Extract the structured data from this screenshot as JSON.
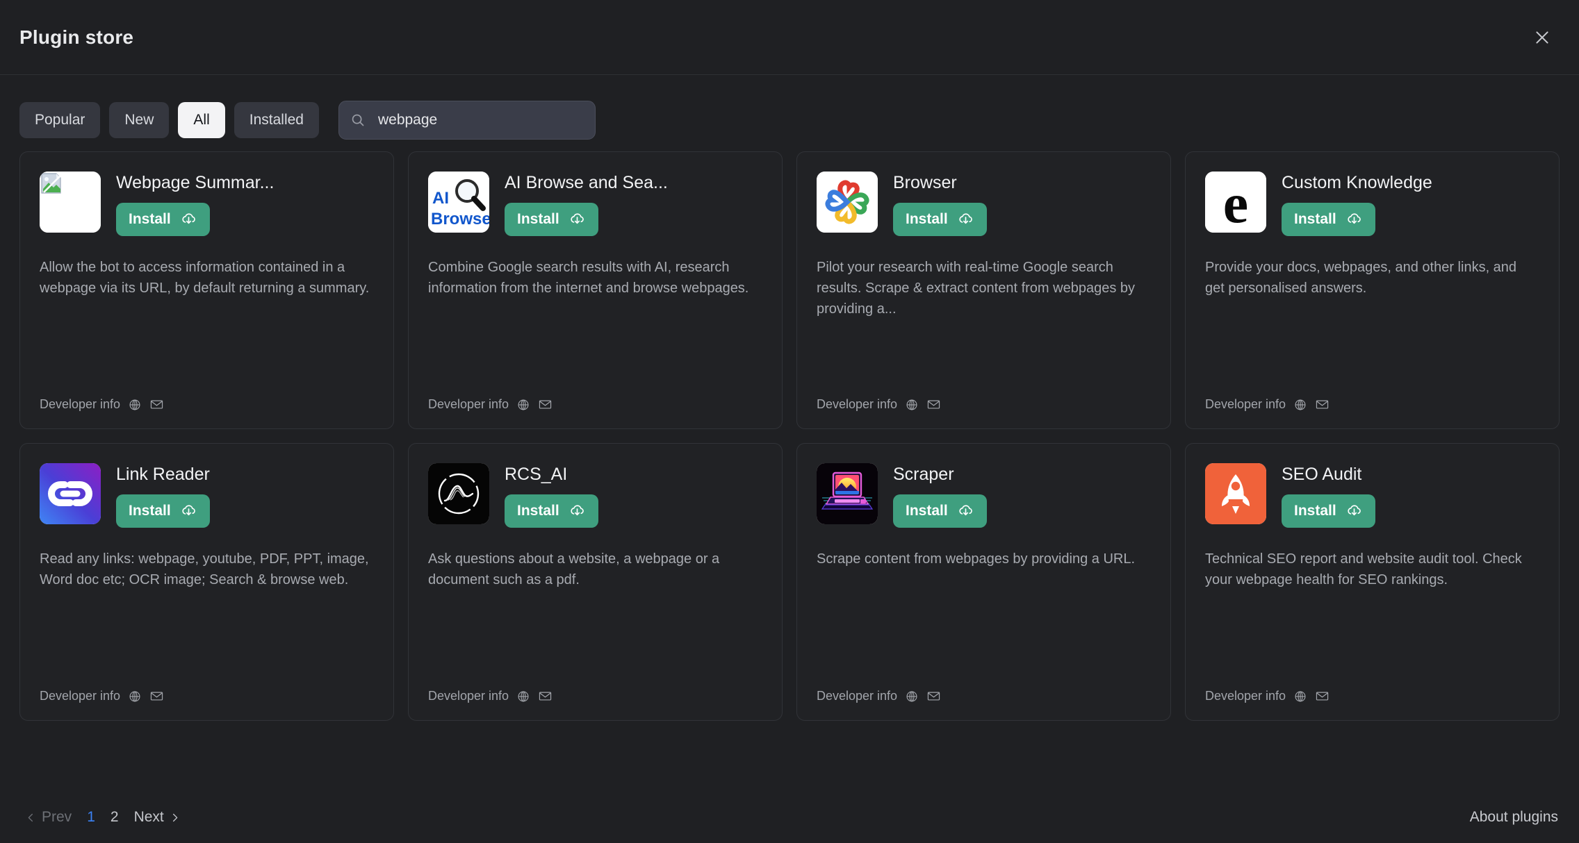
{
  "header": {
    "title": "Plugin store",
    "close_icon": "close-icon"
  },
  "toolbar": {
    "tabs": [
      {
        "label": "Popular",
        "active": false
      },
      {
        "label": "New",
        "active": false
      },
      {
        "label": "All",
        "active": true
      },
      {
        "label": "Installed",
        "active": false
      }
    ],
    "search": {
      "icon": "search-icon",
      "value": "webpage",
      "placeholder": "Search plugins"
    }
  },
  "cards": [
    {
      "name": "Webpage Summar...",
      "icon": "broken-image-icon",
      "install_label": "Install",
      "install_icon": "cloud-download-icon",
      "description": "Allow the bot to access information contained in a webpage via its URL, by default returning a summary.",
      "developer_label": "Developer info",
      "website_icon": "globe-icon",
      "email_icon": "envelope-icon"
    },
    {
      "name": "AI Browse and Sea...",
      "icon": "ai-browse-magnifier-icon",
      "install_label": "Install",
      "install_icon": "cloud-download-icon",
      "description": "Combine Google search results with AI, research information from the internet and browse webpages.",
      "developer_label": "Developer info",
      "website_icon": "globe-icon",
      "email_icon": "envelope-icon"
    },
    {
      "name": "Browser",
      "icon": "four-hearts-pinwheel-icon",
      "install_label": "Install",
      "install_icon": "cloud-download-icon",
      "description": "Pilot your research with real-time Google search results. Scrape & extract content from webpages by providing a...",
      "developer_label": "Developer info",
      "website_icon": "globe-icon",
      "email_icon": "envelope-icon"
    },
    {
      "name": "Custom Knowledge",
      "icon": "letter-e-icon",
      "install_label": "Install",
      "install_icon": "cloud-download-icon",
      "description": "Provide your docs, webpages, and other links, and get personalised answers.",
      "developer_label": "Developer info",
      "website_icon": "globe-icon",
      "email_icon": "envelope-icon"
    },
    {
      "name": "Link Reader",
      "icon": "chain-link-icon",
      "install_label": "Install",
      "install_icon": "cloud-download-icon",
      "description": "Read any links: webpage, youtube, PDF, PPT, image, Word doc etc; OCR image; Search & browse web.",
      "developer_label": "Developer info",
      "website_icon": "globe-icon",
      "email_icon": "envelope-icon"
    },
    {
      "name": "RCS_AI",
      "icon": "circle-wave-icon",
      "install_label": "Install",
      "install_icon": "cloud-download-icon",
      "description": "Ask questions about a website, a webpage or a document such as a pdf.",
      "developer_label": "Developer info",
      "website_icon": "globe-icon",
      "email_icon": "envelope-icon"
    },
    {
      "name": "Scraper",
      "icon": "retro-computer-icon",
      "install_label": "Install",
      "install_icon": "cloud-download-icon",
      "description": "Scrape content from webpages by providing a URL.",
      "developer_label": "Developer info",
      "website_icon": "globe-icon",
      "email_icon": "envelope-icon"
    },
    {
      "name": "SEO Audit",
      "icon": "rocket-icon",
      "install_label": "Install",
      "install_icon": "cloud-download-icon",
      "description": "Technical SEO report and website audit tool. Check your webpage health for SEO rankings.",
      "developer_label": "Developer info",
      "website_icon": "globe-icon",
      "email_icon": "envelope-icon"
    }
  ],
  "footer": {
    "prev_label": "Prev",
    "next_label": "Next",
    "pages": [
      "1",
      "2"
    ],
    "active_page": "1",
    "about_label": "About plugins",
    "active_page_color": "#3b82f6"
  }
}
